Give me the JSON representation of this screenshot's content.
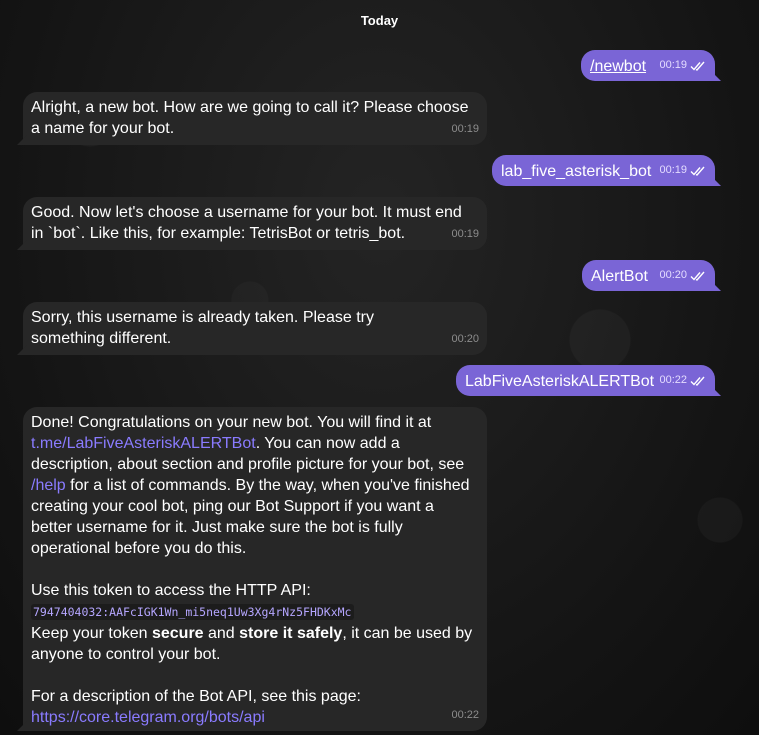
{
  "date_separator": "Today",
  "accent_color": "#7a65d6",
  "link_color": "#8a7bff",
  "messages": [
    {
      "direction": "out",
      "text": "/newbot",
      "time": "00:19",
      "status": "read"
    },
    {
      "direction": "in",
      "text": "Alright, a new bot. How are we going to call it? Please choose a name for your bot.",
      "time": "00:19"
    },
    {
      "direction": "out",
      "text": "lab_five_asterisk_bot",
      "time": "00:19",
      "status": "read"
    },
    {
      "direction": "in",
      "text": "Good. Now let's choose a username for your bot. It must end in `bot`. Like this, for example: TetrisBot or tetris_bot.",
      "time": "00:19"
    },
    {
      "direction": "out",
      "text": "AlertBot",
      "time": "00:20",
      "status": "read"
    },
    {
      "direction": "in",
      "text": "Sorry, this username is already taken. Please try something different.",
      "time": "00:20"
    },
    {
      "direction": "out",
      "text": "LabFiveAsteriskALERTBot",
      "time": "00:22",
      "status": "read"
    },
    {
      "direction": "in",
      "time": "00:22",
      "p1_a": "Done! Congratulations on your new bot. You will find it at ",
      "p1_link": "t.me/LabFiveAsteriskALERTBot",
      "p1_b": ". You can now add a description, about section and profile picture for your bot, see ",
      "p1_help": "/help",
      "p1_c": " for a list of commands. By the way, when you've finished creating your cool bot, ping our Bot Support if you want a better username for it. Just make sure the bot is fully operational before you do this.",
      "p2": "Use this token to access the HTTP API:",
      "token": "7947404032:AAFcIGK1Wn_mi5neq1Uw3Xg4rNz5FHDKxMc",
      "p3_a": "Keep your token ",
      "p3_b1": "secure",
      "p3_and": " and ",
      "p3_b2": "store it safely",
      "p3_c": ", it can be used by anyone to control your bot.",
      "p4": "For a description of the Bot API, see this page:",
      "p4_link": "https://core.telegram.org/bots/api"
    }
  ]
}
